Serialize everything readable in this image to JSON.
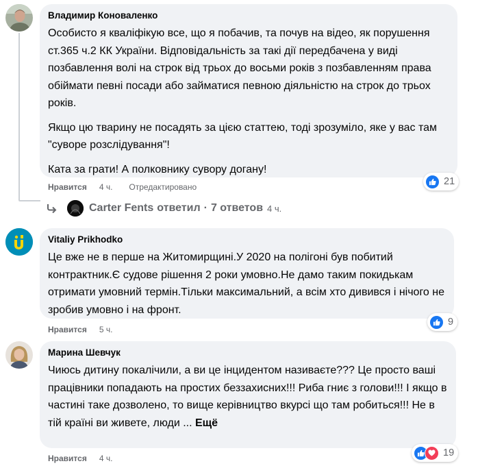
{
  "colors": {
    "bubble_bg": "#f0f2f5",
    "meta_text": "#65676b",
    "like_blue": "#1877f2",
    "love_red": "#f33e58",
    "vitaliy_avatar_bg": "#008eb7",
    "vitaliy_avatar_glyph": "#ffd500"
  },
  "comments": [
    {
      "author": "Владимир Коноваленко",
      "avatar_icon": "user-photo-avatar",
      "paragraphs": [
        "Особисто я кваліфікую все, що я побачив, та почув на відео, як порушення ст.365 ч.2 КК України. Відповідальність за такі дії передбачена у виді позбавлення волі на строк від трьох до восьми років з позбавленням права обіймати певні посади або займатися певною діяльністю на строк до трьох років.",
        "Якщо цю тварину не посадять за цією статтею, тоді зрозуміло, яке у вас там \"суворе розслідування\"!",
        "Ката за грати! А полковнику сувору догану!"
      ],
      "like_label": "Нравится",
      "time": "4 ч.",
      "edited": "Отредактировано",
      "reaction_icons": [
        "like-reaction-icon"
      ],
      "reaction_count": "21",
      "reply_summary": {
        "author": "Carter Fents",
        "verb": "ответил",
        "separator": "·",
        "count": "7 ответов",
        "time": "4 ч."
      }
    },
    {
      "author": "Vitaliy Prikhodko",
      "avatar_icon": "letter-u-avatar",
      "avatar_letter": "u",
      "paragraphs": [
        "Це вже не в перше на Житомирщині.У 2020 на полігоні був побитий контрактник.Є судове рішення 2 роки умовно.Не дамо таким покидькам отримати умовний термін.Тільки максимальний, а всім хто дивився і нічого не зробив умовно і на фронт."
      ],
      "like_label": "Нравится",
      "time": "5 ч.",
      "reaction_icons": [
        "like-reaction-icon"
      ],
      "reaction_count": "9"
    },
    {
      "author": "Марина Шевчук",
      "avatar_icon": "user-photo-avatar",
      "paragraphs": [
        "Чиюсь дитину покалічили, а ви це інцидентом називаєте??? Це просто ваші працівники попадають на простих беззахисних!!! Риба гниє з голови!!! І якщо в частині таке дозволено, то вище керівництво вкурсі що там робиться!!! Не в тій країні ви живете, люди ..."
      ],
      "see_more": "Ещё",
      "like_label": "Нравится",
      "time": "4 ч.",
      "reaction_icons": [
        "like-reaction-icon",
        "love-reaction-icon"
      ],
      "reaction_count": "19"
    }
  ]
}
